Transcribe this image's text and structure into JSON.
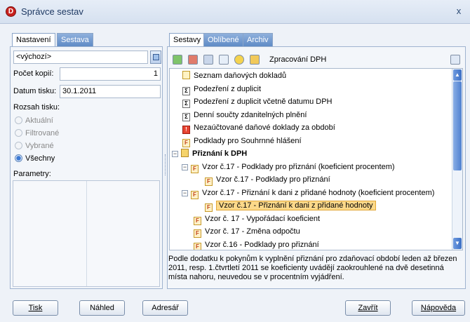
{
  "window": {
    "title": "Správce sestav",
    "close_glyph": "x"
  },
  "left_tabs": [
    "Nastavení",
    "Sestava"
  ],
  "settings": {
    "preset_value": "<výchozí>",
    "copies_label": "Počet kopií:",
    "copies_value": "1",
    "date_label": "Datum tisku:",
    "date_value": "30.1.2011",
    "range_label": "Rozsah tisku:",
    "range_options": [
      "Aktuální",
      "Filtrované",
      "Vybrané",
      "Všechny"
    ],
    "range_selected": "Všechny",
    "params_label": "Parametry:"
  },
  "right_tabs": [
    "Sestavy",
    "Oblíbené",
    "Archiv"
  ],
  "toolbar": {
    "caption": "Zpracování DPH",
    "icons": [
      "add-report-icon",
      "delete-report-icon",
      "edit-report-icon",
      "preview-report-icon",
      "favorite-star-icon",
      "export-icon"
    ]
  },
  "report_list": [
    {
      "text": "Seznam daňových dokladů",
      "icon": "doc",
      "level": 0
    },
    {
      "text": "Podezření z duplicit",
      "icon": "sum",
      "level": 0
    },
    {
      "text": "Podezření z duplicit včetně datumu DPH",
      "icon": "sum",
      "level": 0
    },
    {
      "text": "Denní součty zdanitelných plnění",
      "icon": "sum",
      "level": 0
    },
    {
      "text": "Nezaúčtované daňové doklady za období",
      "icon": "warn",
      "level": 0
    },
    {
      "text": "Podklady pro Souhrnné hlášení",
      "icon": "form",
      "level": 0
    },
    {
      "text": "Přiznání k DPH",
      "icon": "folder",
      "level": 0,
      "expander": "−",
      "bold": true
    },
    {
      "text": "Vzor č.17 - Podklady pro přiznání (koeficient procentem)",
      "icon": "form",
      "level": 1,
      "expander": "−"
    },
    {
      "text": "Vzor č.17 - Podklady pro přiznání",
      "icon": "form",
      "level": 2
    },
    {
      "text": "Vzor č.17 - Přiznání k dani z přidané hodnoty (koeficient procentem)",
      "icon": "form",
      "level": 1,
      "expander": "−"
    },
    {
      "text": "Vzor č.17 - Přiznání k dani z přidané hodnoty",
      "icon": "form",
      "level": 2,
      "selected": true
    },
    {
      "text": "Vzor č. 17 - Vypořádací koeficient",
      "icon": "form",
      "level": 1
    },
    {
      "text": "Vzor č. 17 - Změna odpočtu",
      "icon": "form",
      "level": 1
    },
    {
      "text": "Vzor č.16 - Podklady pro přiznání",
      "icon": "form",
      "level": 1
    }
  ],
  "description": "Podle dodatku k pokynům k vyplnění přiznání pro zdaňovací období leden až březen 2011, resp. 1.čtvrtletí 2011 se koeficienty uvádějí zaokrouhlené na dvě desetinná místa nahoru, neuvedou se v procentním vyjádření.",
  "buttons": {
    "print": "Tisk",
    "preview": "Náhled",
    "address": "Adresář",
    "close": "Zavřít",
    "help": "Nápověda"
  }
}
